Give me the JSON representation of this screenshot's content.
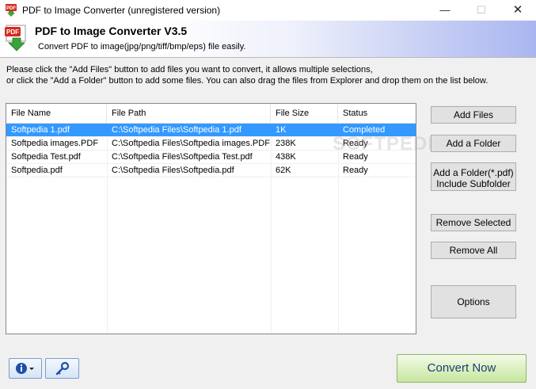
{
  "window": {
    "title": "PDF to Image Converter (unregistered version)",
    "minimize_glyph": "—",
    "maximize_glyph": "☐",
    "close_glyph": "✕"
  },
  "header": {
    "title": "PDF to Image Converter V3.5",
    "subtitle": "Convert PDF to image(jpg/png/tiff/bmp/eps) file easily.",
    "icon_label": "PDF",
    "icon": "pdf-download-icon"
  },
  "instructions": {
    "line1": "Please click the \"Add Files\" button to add files you want to convert, it allows multiple selections,",
    "line2": "or click the \"Add a Folder\" button to add some files. You can also drag the files from Explorer and drop them on the list below."
  },
  "file_list": {
    "columns": [
      "File Name",
      "File Path",
      "File Size",
      "Status"
    ],
    "rows": [
      {
        "name": "Softpedia 1.pdf",
        "path": "C:\\Softpedia Files\\Softpedia 1.pdf",
        "size": "1K",
        "status": "Completed",
        "selected": true
      },
      {
        "name": "Softpedia images.PDF",
        "path": "C:\\Softpedia Files\\Softpedia images.PDF",
        "size": "238K",
        "status": "Ready",
        "selected": false
      },
      {
        "name": "Softpedia Test.pdf",
        "path": "C:\\Softpedia Files\\Softpedia Test.pdf",
        "size": "438K",
        "status": "Ready",
        "selected": false
      },
      {
        "name": "Softpedia.pdf",
        "path": "C:\\Softpedia Files\\Softpedia.pdf",
        "size": "62K",
        "status": "Ready",
        "selected": false
      }
    ]
  },
  "buttons": {
    "add_files": "Add Files",
    "add_folder": "Add a Folder",
    "add_folder_sub_line1": "Add a Folder(*.pdf)",
    "add_folder_sub_line2": "Include Subfolder",
    "remove_selected": "Remove Selected",
    "remove_all": "Remove All",
    "options": "Options",
    "convert_now": "Convert Now"
  },
  "watermark": "SOFTPEDIA",
  "colors": {
    "selection": "#3399ff",
    "header_gradient_end": "#aab6f0",
    "convert_button": "#c7e6a0",
    "convert_text": "#1f3d73"
  }
}
